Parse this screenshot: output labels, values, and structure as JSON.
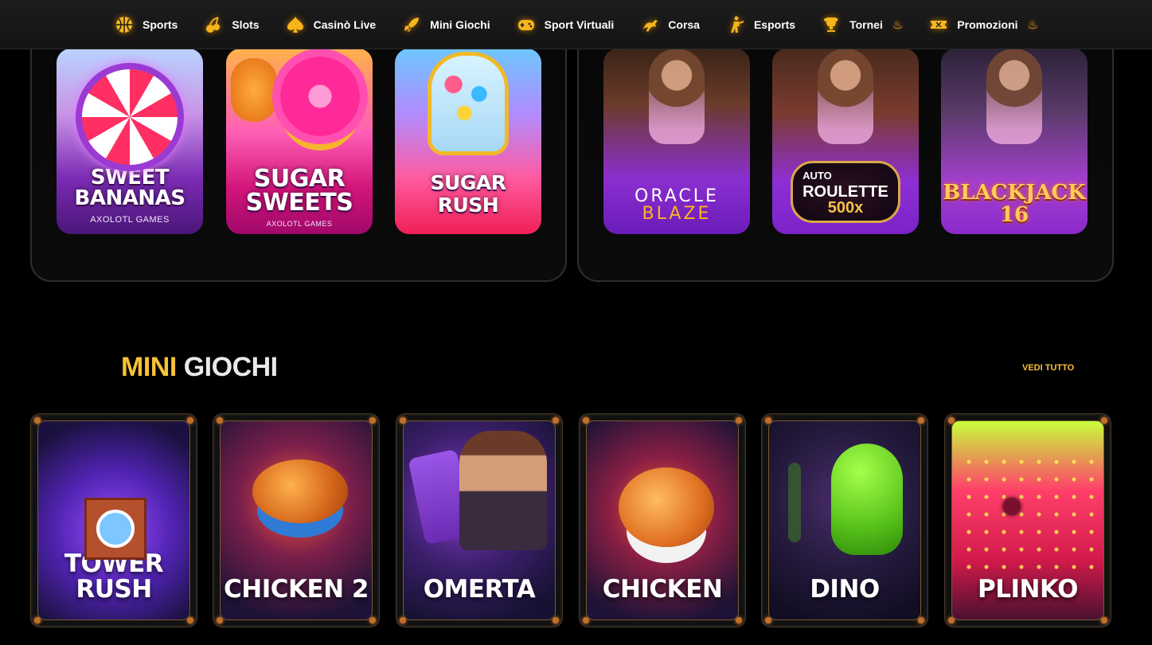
{
  "nav": {
    "items": [
      {
        "label": "Sports",
        "icon": "basketball-icon"
      },
      {
        "label": "Slots",
        "icon": "cherry-icon"
      },
      {
        "label": "Casinò Live",
        "icon": "spade-icon"
      },
      {
        "label": "Mini Giochi",
        "icon": "rocket-icon"
      },
      {
        "label": "Sport Virtuali",
        "icon": "gamepad-icon"
      },
      {
        "label": "Corsa",
        "icon": "horse-icon"
      },
      {
        "label": "Esports",
        "icon": "soldier-icon"
      },
      {
        "label": "Tornei",
        "icon": "trophy-icon",
        "badge": "flame"
      },
      {
        "label": "Promozioni",
        "icon": "ticket-icon",
        "badge": "flame"
      }
    ]
  },
  "slots": [
    {
      "title_lines": [
        "SWEET",
        "BANANAS"
      ],
      "provider": "AXOLOTL GAMES"
    },
    {
      "title_lines": [
        "SUGAR",
        "SWEETS"
      ],
      "provider": "AXOLOTL GAMES"
    },
    {
      "title_lines": [
        "SUGAR",
        "RUSH"
      ],
      "provider": ""
    }
  ],
  "live": [
    {
      "line1": "ORACLE",
      "line2": "BLAZE"
    },
    {
      "line1": "AUTO",
      "line2": "ROULETTE",
      "line3": "500x"
    },
    {
      "line1": "BLACKJACK",
      "line2": "16"
    }
  ],
  "mini_section": {
    "title_highlight": "MINI",
    "title_rest": "GIOCHI",
    "see_all": "VEDI TUTTO"
  },
  "mini_games": [
    {
      "title_lines": [
        "TOWER",
        "RUSH"
      ]
    },
    {
      "title_lines": [
        "CHICKEN 2"
      ]
    },
    {
      "title_lines": [
        "OMERTA"
      ]
    },
    {
      "title_lines": [
        "CHICKEN"
      ]
    },
    {
      "title_lines": [
        "DINO"
      ]
    },
    {
      "title_lines": [
        "PLINKO"
      ]
    }
  ],
  "colors": {
    "accent": "#f7c234",
    "background": "#000000",
    "nav_bg": "#181818"
  }
}
